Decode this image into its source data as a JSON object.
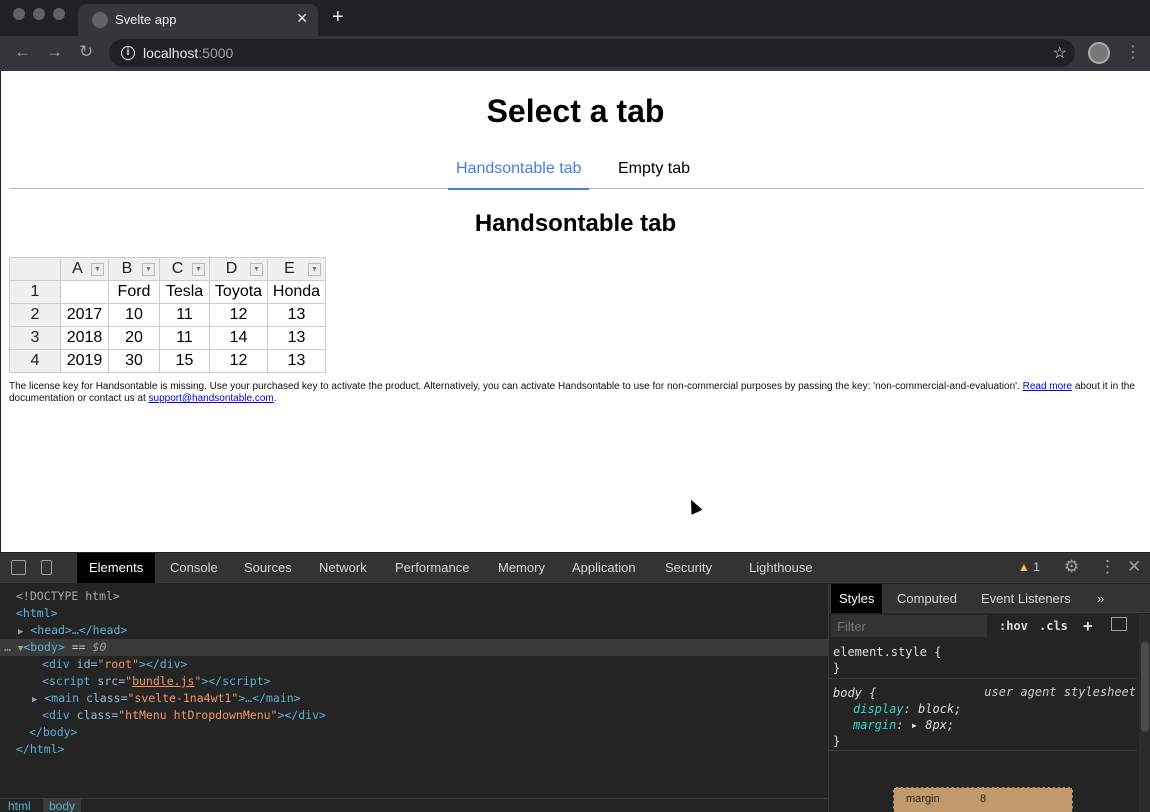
{
  "browser": {
    "tab_title": "Svelte app",
    "tab_close": "✕",
    "new_tab": "+",
    "url_host": "localhost",
    "url_port": ":5000"
  },
  "page": {
    "title": "Select a tab",
    "tabs": [
      {
        "label": "Handsontable tab",
        "active": true
      },
      {
        "label": "Empty tab",
        "active": false
      }
    ],
    "section_title": "Handsontable tab",
    "table": {
      "col_headers": [
        "A",
        "B",
        "C",
        "D",
        "E"
      ],
      "rows": [
        {
          "header": "1",
          "cells": [
            "",
            "Ford",
            "Tesla",
            "Toyota",
            "Honda"
          ]
        },
        {
          "header": "2",
          "cells": [
            "2017",
            "10",
            "11",
            "12",
            "13"
          ]
        },
        {
          "header": "3",
          "cells": [
            "2018",
            "20",
            "11",
            "14",
            "13"
          ]
        },
        {
          "header": "4",
          "cells": [
            "2019",
            "30",
            "15",
            "12",
            "13"
          ]
        }
      ]
    },
    "license": {
      "text_before": "The license key for Handsontable is missing. Use your purchased key to activate the product. Alternatively, you can activate Handsontable to use for non-commercial purposes by passing the key: 'non-commercial-and-evaluation'. ",
      "read_more": "Read more",
      "text_middle": " about it in the documentation or contact us at ",
      "email": "support@handsontable.com",
      "text_after": "."
    }
  },
  "devtools": {
    "tabs": [
      "Elements",
      "Console",
      "Sources",
      "Network",
      "Performance",
      "Memory",
      "Application",
      "Security",
      "Lighthouse"
    ],
    "active_tab": "Elements",
    "warning_count": "1",
    "dom": {
      "doctype": "<!DOCTYPE html>",
      "html_open": "<html>",
      "head": "<head>…</head>",
      "body_open": "<body>",
      "body_eq": " == ",
      "body_dollar": "$0",
      "div_root_tag": "div",
      "div_root_attr": "id",
      "div_root_val": "\"root\"",
      "script_tag": "script",
      "script_attr": "src",
      "script_val": "bundle.js",
      "main_tag": "main",
      "main_attr": "class",
      "main_val": "\"svelte-1na4wt1\"",
      "menu_tag": "div",
      "menu_attr": "class",
      "menu_val": "\"htMenu htDropdownMenu\"",
      "body_close": "</body>",
      "html_close": "</html>"
    },
    "breadcrumbs": [
      "html",
      "body"
    ],
    "styles_panel": {
      "tabs": [
        "Styles",
        "Computed",
        "Event Listeners"
      ],
      "more": "»",
      "filter_placeholder": "Filter",
      "hov": ":hov",
      "cls": ".cls",
      "plus": "+",
      "element_style": "element.style {",
      "close_brace": "}",
      "body_selector": "body {",
      "ua_label": "user agent stylesheet",
      "prop1_name": "display",
      "prop1_value": ": block;",
      "prop2_name": "margin",
      "prop2_value": ": ▸ 8px;",
      "box_label": "margin",
      "box_value": "8"
    }
  }
}
